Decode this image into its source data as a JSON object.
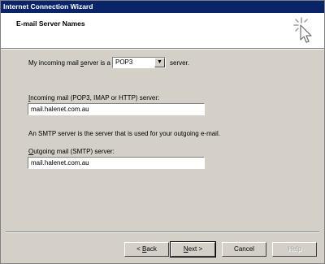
{
  "window": {
    "title": "Internet Connection Wizard"
  },
  "header": {
    "title": "E-mail Server Names",
    "icon": "wizard-cursor-icon"
  },
  "form": {
    "incoming_type_prefix": "My incoming mail ",
    "incoming_type_prefix_accel": "s",
    "incoming_type_prefix_rest": "erver is a",
    "incoming_type_value": "POP3",
    "incoming_type_suffix": "server.",
    "incoming_label_accel": "I",
    "incoming_label_rest": "ncoming mail (POP3, IMAP or HTTP) server:",
    "incoming_value": "mail.halenet.com.au",
    "smtp_description": "An SMTP server is the server that is used for your outgoing e-mail.",
    "outgoing_label_accel": "O",
    "outgoing_label_rest": "utgoing mail (SMTP) server:",
    "outgoing_value": "mail.halenet.com.au"
  },
  "buttons": {
    "back_prefix": "< ",
    "back_accel": "B",
    "back_rest": "ack",
    "next_accel": "N",
    "next_rest": "ext >",
    "cancel": "Cancel",
    "help": "Help"
  }
}
